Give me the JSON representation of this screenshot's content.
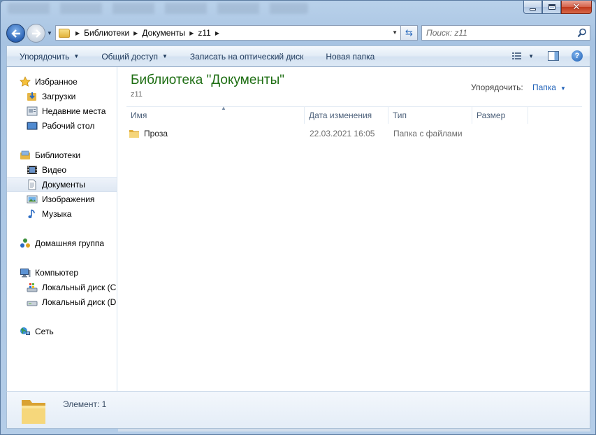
{
  "window": {
    "controls": {
      "minimize": "minimize",
      "maximize": "maximize",
      "close": "✕"
    }
  },
  "navigation": {
    "back": "back",
    "forward": "forward",
    "breadcrumb": [
      "Библиотеки",
      "Документы",
      "z11"
    ],
    "search_placeholder": "Поиск: z11"
  },
  "toolbar": {
    "items": [
      {
        "label": "Упорядочить",
        "dropdown": true
      },
      {
        "label": "Общий доступ",
        "dropdown": true
      },
      {
        "label": "Записать на оптический диск",
        "dropdown": false
      },
      {
        "label": "Новая папка",
        "dropdown": false
      }
    ]
  },
  "sidebar": {
    "groups": [
      {
        "label": "Избранное",
        "icon": "star-icon",
        "items": [
          {
            "label": "Загрузки",
            "icon": "downloads-folder-icon"
          },
          {
            "label": "Недавние места",
            "icon": "recent-places-icon"
          },
          {
            "label": "Рабочий стол",
            "icon": "desktop-icon"
          }
        ]
      },
      {
        "label": "Библиотеки",
        "icon": "libraries-icon",
        "items": [
          {
            "label": "Видео",
            "icon": "video-library-icon"
          },
          {
            "label": "Документы",
            "icon": "documents-library-icon",
            "selected": true
          },
          {
            "label": "Изображения",
            "icon": "pictures-library-icon"
          },
          {
            "label": "Музыка",
            "icon": "music-library-icon"
          }
        ]
      },
      {
        "label": "Домашняя группа",
        "icon": "homegroup-icon",
        "items": []
      },
      {
        "label": "Компьютер",
        "icon": "computer-icon",
        "items": [
          {
            "label": "Локальный диск (C:)",
            "icon": "system-drive-icon"
          },
          {
            "label": "Локальный диск (D:)",
            "icon": "drive-icon"
          }
        ]
      },
      {
        "label": "Сеть",
        "icon": "network-icon",
        "items": []
      }
    ]
  },
  "main": {
    "title": "Библиотека \"Документы\"",
    "subtitle": "z11",
    "arrange_label": "Упорядочить:",
    "arrange_value": "Папка",
    "columns": [
      "Имя",
      "Дата изменения",
      "Тип",
      "Размер"
    ],
    "rows": [
      {
        "name": "Проза",
        "modified": "22.03.2021 16:05",
        "type": "Папка с файлами",
        "size": ""
      }
    ]
  },
  "status": {
    "text": "Элемент: 1"
  },
  "colors": {
    "title_green": "#1e6e13",
    "link_blue": "#1f61b8",
    "accent": "#2c63b5"
  }
}
